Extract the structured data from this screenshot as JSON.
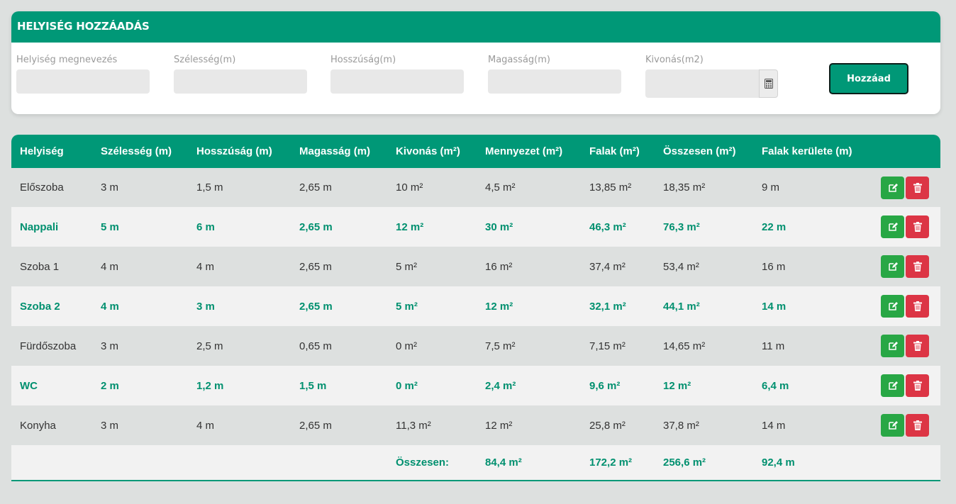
{
  "add_form": {
    "title": "HELYISÉG HOZZÁADÁS",
    "fields": [
      {
        "label": "Helyiség megnevezés",
        "value": "",
        "placeholder": ""
      },
      {
        "label": "Szélesség(m)",
        "value": "",
        "placeholder": ""
      },
      {
        "label": "Hosszúság(m)",
        "value": "",
        "placeholder": ""
      },
      {
        "label": "Magasság(m)",
        "value": "",
        "placeholder": ""
      },
      {
        "label": "Kivonás(m2)",
        "value": "",
        "placeholder": ""
      }
    ],
    "calculator_icon": "calculator-icon",
    "add_label": "Hozzáad"
  },
  "table": {
    "headers": [
      "Helyiség",
      "Szélesség (m)",
      "Hosszúság (m)",
      "Magasság (m)",
      "Kivonás (m²)",
      "Mennyezet (m²)",
      "Falak (m²)",
      "Összesen (m²)",
      "Falak kerülete (m)"
    ],
    "rows": [
      [
        "Előszoba",
        "3 m",
        "1,5 m",
        "2,65 m",
        "10 m²",
        "4,5 m²",
        "13,85 m²",
        "18,35 m²",
        "9 m"
      ],
      [
        "Nappali",
        "5 m",
        "6 m",
        "2,65 m",
        "12 m²",
        "30 m²",
        "46,3 m²",
        "76,3 m²",
        "22 m"
      ],
      [
        "Szoba 1",
        "4 m",
        "4 m",
        "2,65 m",
        "5 m²",
        "16 m²",
        "37,4 m²",
        "53,4 m²",
        "16 m"
      ],
      [
        "Szoba 2",
        "4 m",
        "3 m",
        "2,65 m",
        "5 m²",
        "12 m²",
        "32,1 m²",
        "44,1 m²",
        "14 m"
      ],
      [
        "Fürdőszoba",
        "3 m",
        "2,5 m",
        "0,65 m",
        "0 m²",
        "7,5 m²",
        "7,15 m²",
        "14,65 m²",
        "11 m"
      ],
      [
        "WC",
        "2 m",
        "1,2 m",
        "1,5 m",
        "0 m²",
        "2,4 m²",
        "9,6 m²",
        "12 m²",
        "6,4 m"
      ],
      [
        "Konyha",
        "3 m",
        "4 m",
        "2,65 m",
        "11,3 m²",
        "12 m²",
        "25,8 m²",
        "37,8 m²",
        "14 m"
      ]
    ],
    "totals": {
      "label": "Összesen:",
      "ceiling": "84,4 m²",
      "walls": "172,2 m²",
      "total": "256,6 m²",
      "perimeter": "92,4 m"
    },
    "row_action_icons": [
      "edit-icon",
      "trash-icon"
    ]
  },
  "colors": {
    "primary": "#009877",
    "edit": "#28a745",
    "delete": "#dc3545",
    "background": "#dde0df"
  }
}
